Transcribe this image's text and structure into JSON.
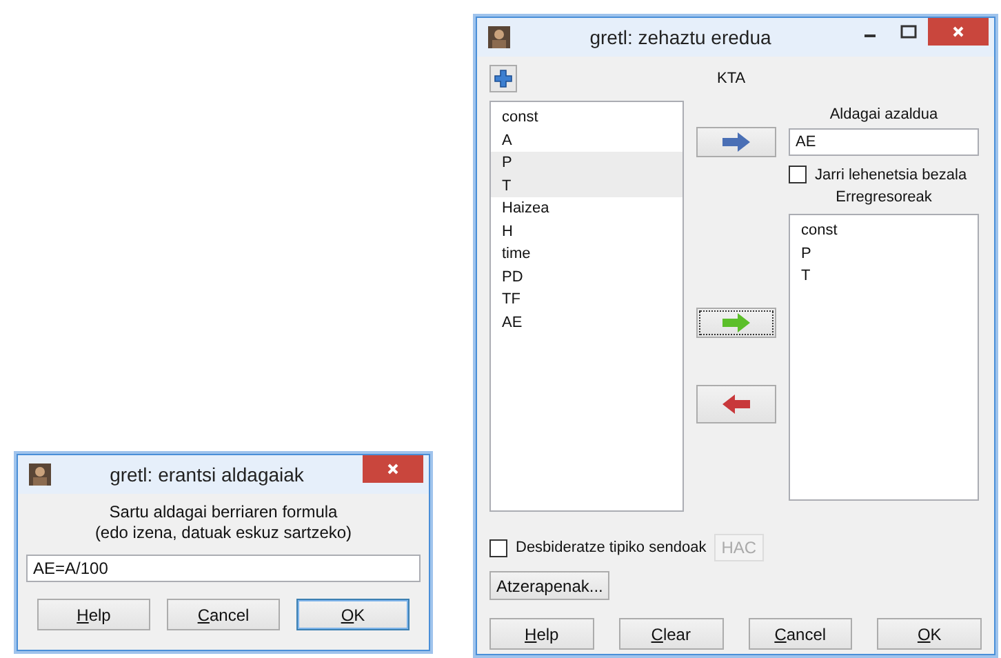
{
  "add_variable_dialog": {
    "title": "gretl: erantsi aldagaiak",
    "controls": [
      {
        "kind": "close"
      }
    ],
    "prompt": "Sartu aldagai berriaren formula",
    "prompt_note": "(edo izena, datuak eskuz sartzeko)",
    "formula": "AE=A/100",
    "buttons": [
      {
        "label": "Help",
        "mnemonic": true,
        "default": false
      },
      {
        "label": "Cancel",
        "mnemonic": true,
        "default": false
      },
      {
        "label": "OK",
        "mnemonic": true,
        "default": true
      }
    ]
  },
  "model_dialog": {
    "title": "gretl: zehaztu eredua",
    "controls": [
      {
        "kind": "minimize"
      },
      {
        "kind": "maximize"
      },
      {
        "kind": "close"
      }
    ],
    "heading": "KTA",
    "variables": [
      {
        "name": "const",
        "selected": false
      },
      {
        "name": "A",
        "selected": false
      },
      {
        "name": "P",
        "selected": true
      },
      {
        "name": "T",
        "selected": true
      },
      {
        "name": "Haizea",
        "selected": false
      },
      {
        "name": "H",
        "selected": false
      },
      {
        "name": "time",
        "selected": false
      },
      {
        "name": "PD",
        "selected": false
      },
      {
        "name": "TF",
        "selected": false
      },
      {
        "name": "AE",
        "selected": false
      }
    ],
    "arrow_buttons": [
      {
        "kind": "right",
        "color": "#4a6fb5",
        "focused": false
      },
      {
        "kind": "right",
        "color": "#5cbf2a",
        "focused": true
      },
      {
        "kind": "left",
        "color": "#c8383b",
        "focused": false
      }
    ],
    "dependent_label": "Aldagai azaldua",
    "dependent_value": "AE",
    "default_checkbox": {
      "label": "Jarri lehenetsia bezala",
      "checked": false
    },
    "regressors_label": "Erregresoreak",
    "regressors": [
      "const",
      "P",
      "T"
    ],
    "robust_checkbox": {
      "label": "Desbideratze tipiko sendoak",
      "checked": false
    },
    "hac_button": {
      "label": "HAC",
      "disabled": true
    },
    "lags_button": "Atzerapenak...",
    "buttons": [
      {
        "label": "Help",
        "mnemonic": true,
        "default": false
      },
      {
        "label": "Clear",
        "mnemonic": true,
        "default": false
      },
      {
        "label": "Cancel",
        "mnemonic": true,
        "default": false
      },
      {
        "label": "OK",
        "mnemonic": true,
        "default": false
      }
    ]
  }
}
